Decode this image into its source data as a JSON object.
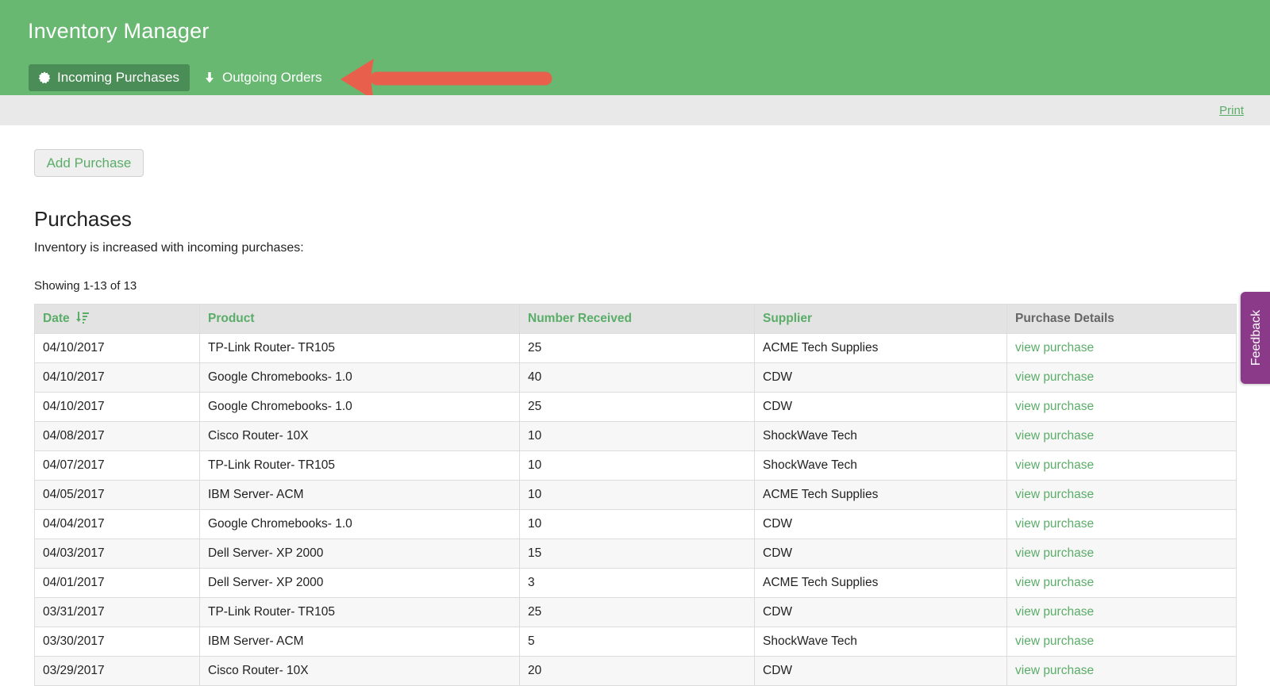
{
  "app": {
    "title": "Inventory Manager"
  },
  "nav": {
    "tabs": [
      {
        "label": "Incoming Purchases",
        "icon": "badge-icon",
        "active": true
      },
      {
        "label": "Outgoing Orders",
        "icon": "arrow-down-icon",
        "active": false
      }
    ]
  },
  "toolbar": {
    "print_label": "Print"
  },
  "actions": {
    "add_purchase_label": "Add Purchase"
  },
  "section": {
    "title": "Purchases",
    "description": "Inventory is increased with incoming purchases:",
    "showing": "Showing 1-13 of 13"
  },
  "table": {
    "headers": [
      "Date",
      "Product",
      "Number Received",
      "Supplier",
      "Purchase Details"
    ],
    "link_label": "view purchase",
    "rows": [
      [
        "04/10/2017",
        "TP-Link Router- TR105",
        "25",
        "ACME Tech Supplies"
      ],
      [
        "04/10/2017",
        "Google Chromebooks- 1.0",
        "40",
        "CDW"
      ],
      [
        "04/10/2017",
        "Google Chromebooks- 1.0",
        "25",
        "CDW"
      ],
      [
        "04/08/2017",
        "Cisco Router- 10X",
        "10",
        "ShockWave Tech"
      ],
      [
        "04/07/2017",
        "TP-Link Router- TR105",
        "10",
        "ShockWave Tech"
      ],
      [
        "04/05/2017",
        "IBM Server- ACM",
        "10",
        "ACME Tech Supplies"
      ],
      [
        "04/04/2017",
        "Google Chromebooks- 1.0",
        "10",
        "CDW"
      ],
      [
        "04/03/2017",
        "Dell Server- XP 2000",
        "15",
        "CDW"
      ],
      [
        "04/01/2017",
        "Dell Server- XP 2000",
        "3",
        "ACME Tech Supplies"
      ],
      [
        "03/31/2017",
        "TP-Link Router- TR105",
        "25",
        "CDW"
      ],
      [
        "03/30/2017",
        "IBM Server- ACM",
        "5",
        "ShockWave Tech"
      ],
      [
        "03/29/2017",
        "Cisco Router- 10X",
        "20",
        "CDW"
      ]
    ]
  },
  "feedback": {
    "label": "Feedback"
  },
  "colors": {
    "header": "#68b872",
    "active_tab": "#4a8d56",
    "accent": "#5aad68",
    "arrow": "#e8604c",
    "feedback": "#8b3a8a"
  }
}
